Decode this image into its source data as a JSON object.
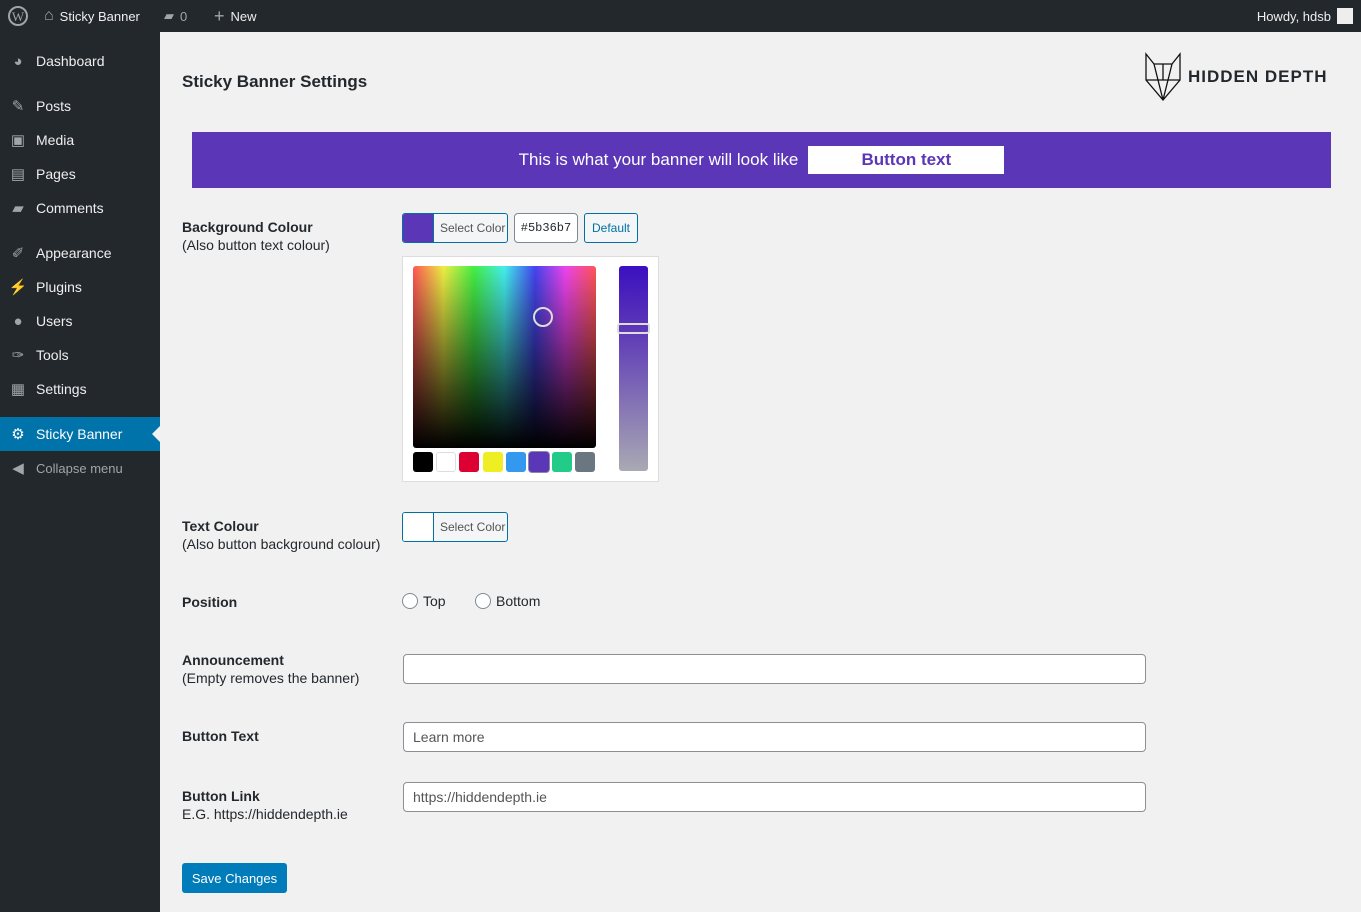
{
  "adminbar": {
    "site": "Sticky Banner",
    "comments": "0",
    "new": "New",
    "howdy": "Howdy, hdsb"
  },
  "sidebar": {
    "items": [
      {
        "label": "Dashboard",
        "icon": "dashboard-icon",
        "glyph": "◕"
      },
      {
        "label": "Posts",
        "icon": "pin-icon",
        "glyph": "✎"
      },
      {
        "label": "Media",
        "icon": "media-icon",
        "glyph": "▣"
      },
      {
        "label": "Pages",
        "icon": "pages-icon",
        "glyph": "▤"
      },
      {
        "label": "Comments",
        "icon": "comment-icon",
        "glyph": "▰"
      },
      {
        "label": "Appearance",
        "icon": "brush-icon",
        "glyph": "✐"
      },
      {
        "label": "Plugins",
        "icon": "plugin-icon",
        "glyph": "⚡"
      },
      {
        "label": "Users",
        "icon": "user-icon",
        "glyph": "●"
      },
      {
        "label": "Tools",
        "icon": "wrench-icon",
        "glyph": "✑"
      },
      {
        "label": "Settings",
        "icon": "settings-icon",
        "glyph": "▦"
      },
      {
        "label": "Sticky Banner",
        "icon": "gear-icon",
        "glyph": "⚙"
      },
      {
        "label": "Collapse menu",
        "icon": "collapse-icon",
        "glyph": "◀"
      }
    ]
  },
  "page": {
    "title": "Sticky Banner Settings",
    "logo_text": "HIDDEN DEPTH"
  },
  "banner": {
    "text": "This is what your banner will look like",
    "button": "Button text",
    "bg": "#5b36b7",
    "fg": "#ffffff"
  },
  "bg_colour": {
    "label": "Background Colour",
    "sub": "(Also button text colour)",
    "select": "Select Color",
    "hex": "#5b36b7",
    "default": "Default",
    "palette": [
      "#000000",
      "#ffffff",
      "#dd0033",
      "#eeee22",
      "#3399ee",
      "#5b36b7",
      "#22cc88",
      "#6b7780"
    ]
  },
  "text_colour": {
    "label": "Text Colour",
    "sub": "(Also button background colour)",
    "select": "Select Color"
  },
  "position": {
    "label": "Position",
    "options": [
      "Top",
      "Bottom"
    ]
  },
  "announcement": {
    "label": "Announcement",
    "sub": "(Empty removes the banner)",
    "value": ""
  },
  "button_text": {
    "label": "Button Text",
    "value": "Learn more"
  },
  "button_link": {
    "label": "Button Link",
    "sub": "E.G. https://hiddendepth.ie",
    "value": "https://hiddendepth.ie"
  },
  "save": "Save Changes"
}
